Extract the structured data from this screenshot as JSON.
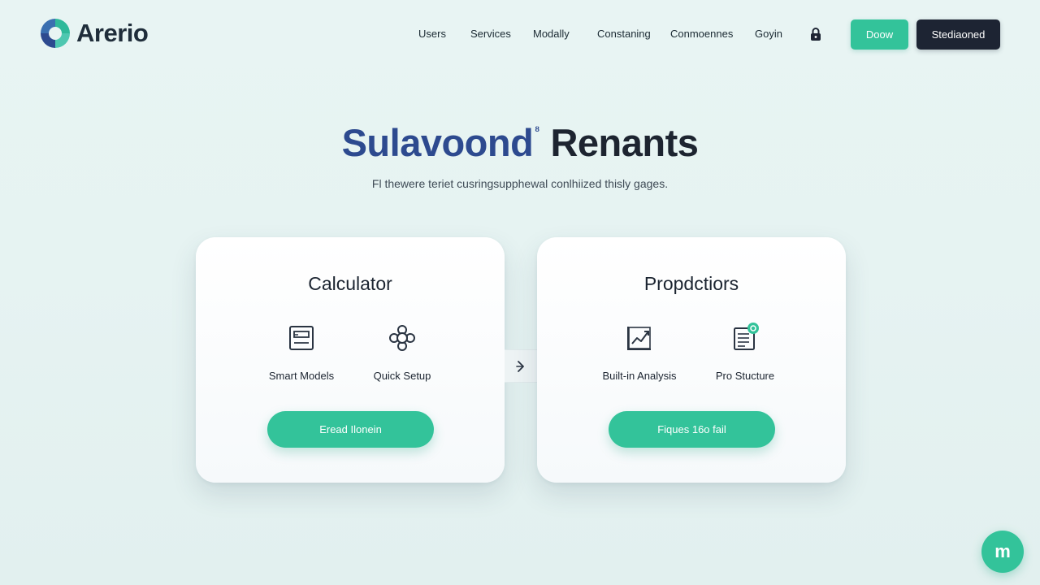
{
  "brand": {
    "name": "Arerio",
    "logo_icon": "brand-logo-icon"
  },
  "nav": {
    "items": [
      {
        "label": "Users"
      },
      {
        "label": "Services"
      },
      {
        "label": "Modally"
      },
      {
        "label": "Constaning"
      },
      {
        "label": "Conmoennes"
      },
      {
        "label": "Goyin"
      }
    ],
    "lock_icon": "lock-icon"
  },
  "header_buttons": {
    "demo": "Doow",
    "start": "Stediaoned"
  },
  "hero": {
    "title_part1": "Sulavoond",
    "title_mark": "ᴽ",
    "title_part2": "Renants",
    "subtitle": "Fl thewere teriet cusringsupphewal conlhiized thisly gages."
  },
  "cards": [
    {
      "title": "Calculator",
      "features": [
        {
          "label": "Smart Models",
          "icon": "calculator-screen-icon"
        },
        {
          "label": "Quick Setup",
          "icon": "settings-cog-icon"
        }
      ],
      "cta": "Eread Ilonein"
    },
    {
      "title": "Propdctiors",
      "features": [
        {
          "label": "Built-in Analysis",
          "icon": "chart-line-icon"
        },
        {
          "label": "Pro Stucture",
          "icon": "document-check-icon"
        }
      ],
      "cta": "Fiques 16o fail"
    }
  ],
  "connector": {
    "icon": "arrow-right-icon"
  },
  "chat": {
    "label": "m"
  },
  "colors": {
    "accent": "#33c39a",
    "dark": "#1d2433",
    "title_blue": "#2d4a8f",
    "background": "#e6f3f2"
  }
}
